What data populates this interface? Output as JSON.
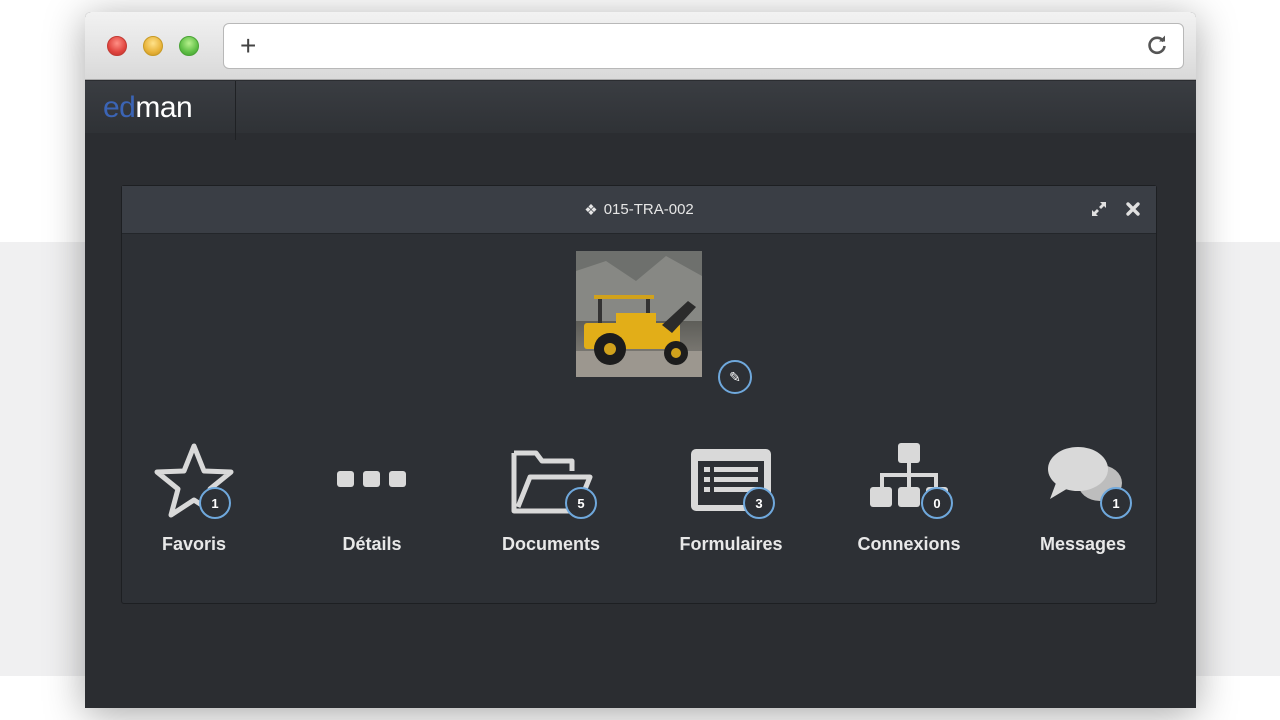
{
  "browser": {
    "new_tab_symbol": "+",
    "url": ""
  },
  "app": {
    "logo_prefix": "ed",
    "logo_suffix": "man",
    "accent_color": "#3b64b5"
  },
  "panel": {
    "title": "015-TRA-002",
    "title_icon": "cubes-icon",
    "tools": [
      "expand-icon",
      "close-icon"
    ],
    "image_alt": "yellow-utility-vehicle-photo",
    "edit_icon": "pencil-icon"
  },
  "tiles": [
    {
      "label": "Favoris",
      "icon": "star-icon",
      "badge": "1"
    },
    {
      "label": "Détails",
      "icon": "ellipsis-icon",
      "badge": null
    },
    {
      "label": "Documents",
      "icon": "folder-icon",
      "badge": "5"
    },
    {
      "label": "Formulaires",
      "icon": "list-form-icon",
      "badge": "3"
    },
    {
      "label": "Connexions",
      "icon": "sitemap-icon",
      "badge": "0"
    },
    {
      "label": "Messages",
      "icon": "comments-icon",
      "badge": "1"
    }
  ],
  "colors": {
    "badge_border": "#6fa8dc",
    "icon_fill": "#d9d9d9"
  }
}
